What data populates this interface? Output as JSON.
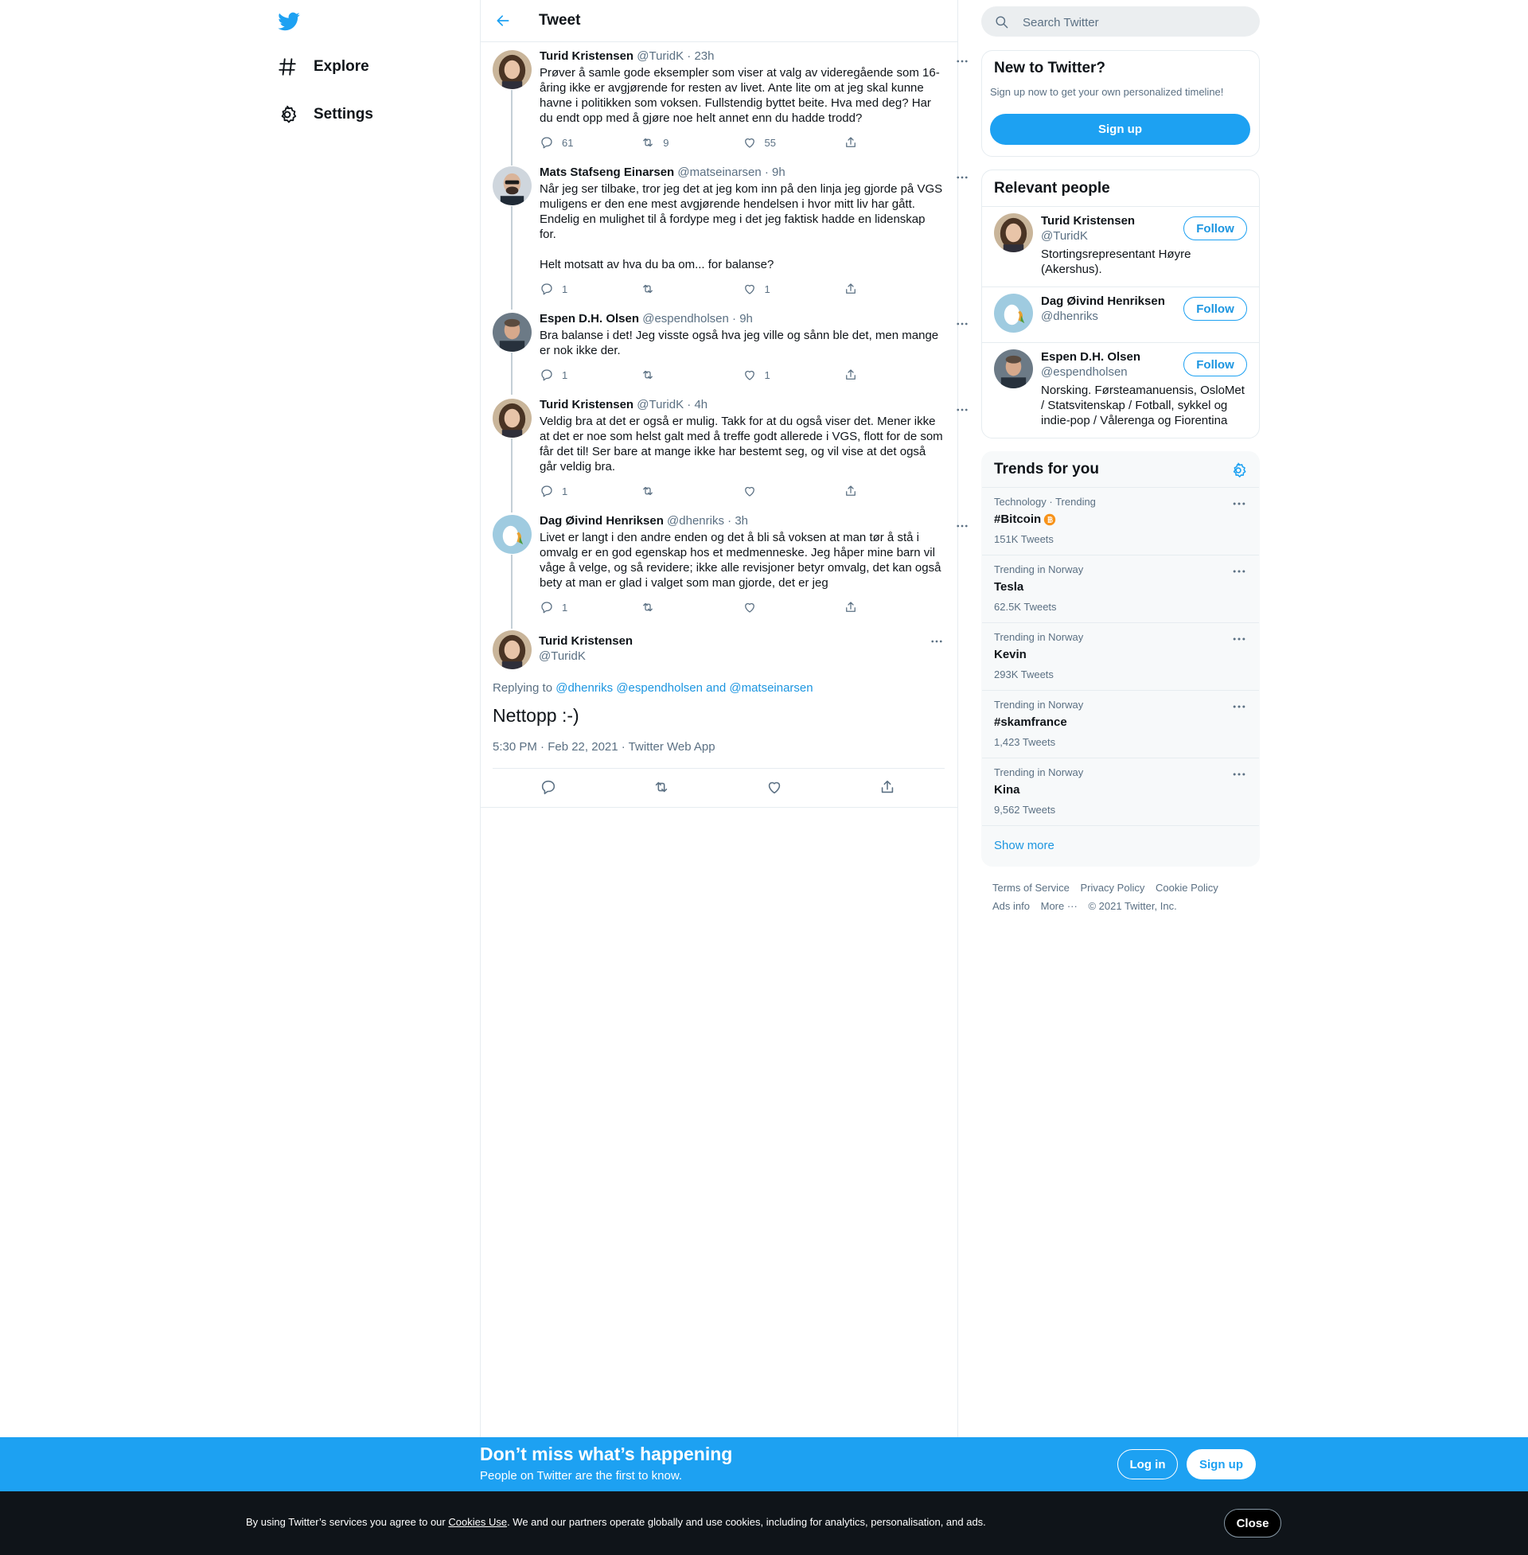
{
  "nav": {
    "items": [
      {
        "label": "Explore"
      },
      {
        "label": "Settings"
      }
    ]
  },
  "header": {
    "title": "Tweet"
  },
  "thread": [
    {
      "name": "Turid Kristensen",
      "handle": "@TuridK",
      "time": "23h",
      "text": "Prøver å samle gode eksempler som viser at valg av videregående som 16-åring ikke er avgjørende for resten av livet. Ante lite om at jeg skal kunne havne i politikken som voksen. Fullstendig byttet beite. Hva med deg? Har du endt opp med å gjøre noe helt annet enn du hadde trodd?",
      "replies": "61",
      "retweets": "9",
      "likes": "55"
    },
    {
      "name": "Mats Stafseng Einarsen",
      "handle": "@matseinarsen",
      "time": "9h",
      "text": "Når jeg ser tilbake, tror jeg det at jeg kom inn på den linja jeg gjorde på VGS muligens er den ene mest avgjørende hendelsen i hvor mitt liv har gått. Endelig en mulighet til å fordype meg i det jeg faktisk hadde en lidenskap for.\n\nHelt motsatt av hva du ba om... for balanse?",
      "replies": "1",
      "retweets": "",
      "likes": "1"
    },
    {
      "name": "Espen D.H. Olsen",
      "handle": "@espendholsen",
      "time": "9h",
      "text": "Bra balanse i det! Jeg visste også hva jeg ville og sånn ble det, men mange er nok ikke der.",
      "replies": "1",
      "retweets": "",
      "likes": "1"
    },
    {
      "name": "Turid Kristensen",
      "handle": "@TuridK",
      "time": "4h",
      "text": "Veldig bra at det er også er mulig. Takk for at du også viser det. Mener ikke at det er noe som helst galt med å treffe godt allerede i VGS, flott for de som får det til! Ser bare at mange ikke har bestemt seg, og vil vise at det også går veldig bra.",
      "replies": "1",
      "retweets": "",
      "likes": ""
    },
    {
      "name": "Dag Øivind Henriksen",
      "handle": "@dhenriks",
      "time": "3h",
      "text": "Livet er langt i den andre enden og det å bli så voksen at man tør å stå i omvalg er en god egenskap hos et medmenneske. Jeg håper mine barn vil våge å velge, og så revidere; ikke alle revisjoner betyr omvalg, det kan også bety at man er glad i valget som man gjorde, det er jeg",
      "replies": "1",
      "retweets": "",
      "likes": ""
    }
  ],
  "focus": {
    "name": "Turid Kristensen",
    "handle": "@TuridK",
    "replying_prefix": "Replying to",
    "replying_to_1": "@dhenriks",
    "replying_to_2": "@espendholsen",
    "replying_and": "and",
    "replying_to_3": "@matseinarsen",
    "text": "Nettopp :-)",
    "time": "5:30 PM · Feb 22, 2021 · Twitter Web App"
  },
  "search": {
    "placeholder": "Search Twitter"
  },
  "signup_card": {
    "title": "New to Twitter?",
    "subtitle": "Sign up now to get your own personalized timeline!",
    "button": "Sign up"
  },
  "relevant": {
    "title": "Relevant people",
    "follow_label": "Follow",
    "people": [
      {
        "name": "Turid Kristensen",
        "handle": "@TuridK",
        "bio": "Stortingsrepresentant Høyre (Akershus)."
      },
      {
        "name": "Dag Øivind Henriksen",
        "handle": "@dhenriks",
        "bio": ""
      },
      {
        "name": "Espen D.H. Olsen",
        "handle": "@espendholsen",
        "bio": "Norsking. Førsteamanuensis, OsloMet / Statsvitenskap / Fotball, sykkel og indie-pop / Vålerenga og Fiorentina"
      }
    ]
  },
  "trends": {
    "title": "Trends for you",
    "items": [
      {
        "context": "Technology · Trending",
        "name": "#Bitcoin",
        "count": "151K Tweets"
      },
      {
        "context": "Trending in Norway",
        "name": "Tesla",
        "count": "62.5K Tweets"
      },
      {
        "context": "Trending in Norway",
        "name": "Kevin",
        "count": "293K Tweets"
      },
      {
        "context": "Trending in Norway",
        "name": "#skamfrance",
        "count": "1,423 Tweets"
      },
      {
        "context": "Trending in Norway",
        "name": "Kina",
        "count": "9,562 Tweets"
      }
    ],
    "show_more": "Show more"
  },
  "footer": {
    "links": [
      "Terms of Service",
      "Privacy Policy",
      "Cookie Policy",
      "Ads info",
      "More ···"
    ],
    "copyright": "© 2021 Twitter, Inc."
  },
  "banner": {
    "title": "Don’t miss what’s happening",
    "subtitle": "People on Twitter are the first to know.",
    "login": "Log in",
    "signup": "Sign up"
  },
  "cookie": {
    "prefix": "By using Twitter’s services you agree to our ",
    "link": "Cookies Use",
    "suffix": ". We and our partners operate globally and use cookies, including for analytics, personalisation, and ads.",
    "close": "Close"
  },
  "colors": {
    "accent": "#1da1f2",
    "link": "#1b95e0",
    "text": "#0f1419",
    "muted": "#5b7083",
    "border": "#e6ecf0"
  }
}
